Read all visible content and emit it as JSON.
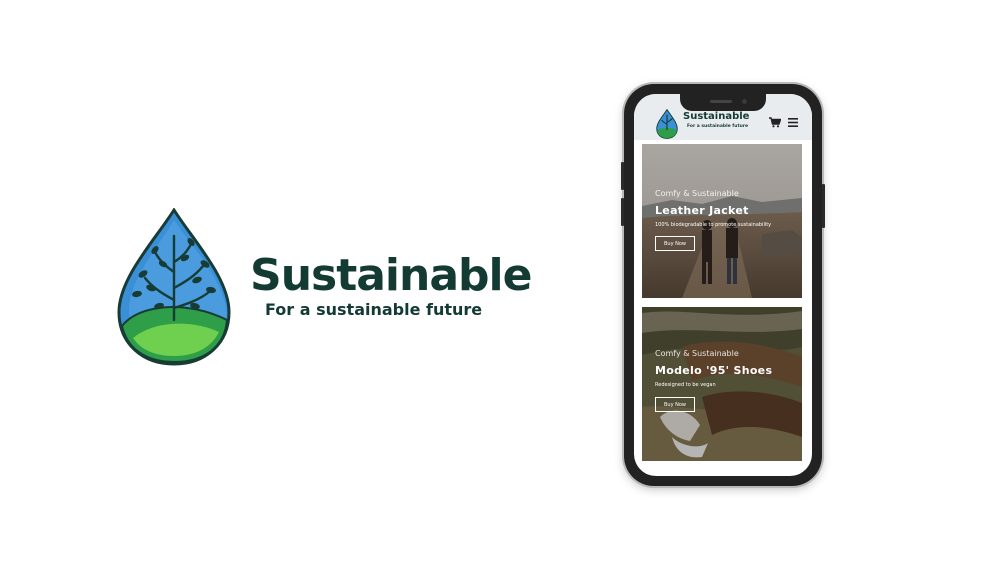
{
  "brand": {
    "title": "Sustainable",
    "tagline": "For a sustainable future"
  },
  "site": {
    "title": "Sustainable",
    "tagline": "For a sustainable future",
    "icons": [
      "cart-icon",
      "menu-icon"
    ]
  },
  "products": [
    {
      "eyebrow": "Comfy & Sustainable",
      "title": "Leather Jacket",
      "description": "100% biodegradable to promote sustainability",
      "button": "Buy Now"
    },
    {
      "eyebrow": "Comfy & Sustainable",
      "title": "Modelo '95' Shoes",
      "description": "Redesigned to be vegan",
      "button": "Buy Now"
    }
  ],
  "colors": {
    "brand_dark": "#143a34",
    "drop_blue": "#3a8fd6",
    "leaf_green": "#2e9e48",
    "header_bg": "#e9ecef"
  }
}
